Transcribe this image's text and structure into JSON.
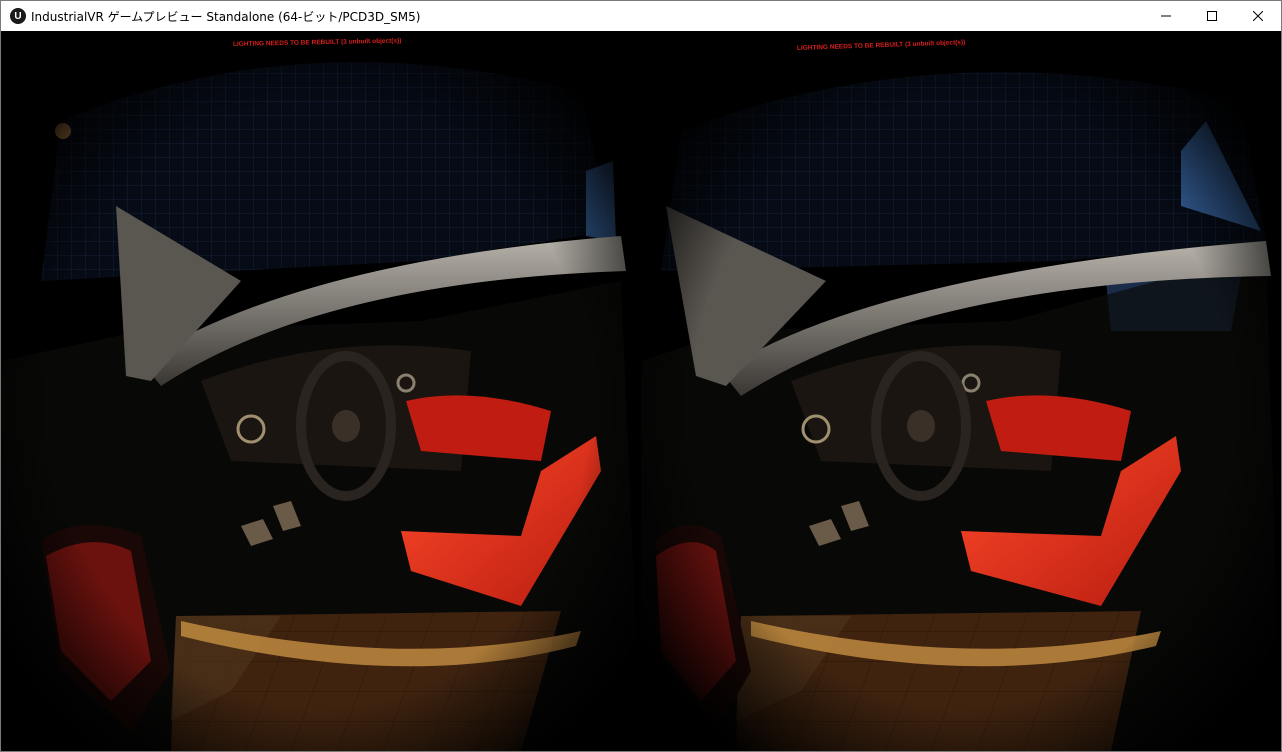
{
  "window": {
    "app_icon_label": "U",
    "title": "IndustrialVR ゲームプレビュー Standalone (64-ビット/PCD3D_SM5)",
    "controls": {
      "minimize_icon": "minimize-icon",
      "maximize_icon": "maximize-icon",
      "close_icon": "close-icon"
    }
  },
  "viewport": {
    "mode": "stereo",
    "left_eye": {
      "warning": "LIGHTING NEEDS TO BE REBUILT (3 unbuilt object(s))"
    },
    "right_eye": {
      "warning": "LIGHTING NEEDS TO BE REBUILT (3 unbuilt object(s))"
    }
  },
  "colors": {
    "titlebar": "#ffffff",
    "warning_text": "#d81f1f",
    "seat_red": "#e2321c",
    "floor_orange": "#c8611f",
    "grid_blue": "#3a5a8c"
  }
}
